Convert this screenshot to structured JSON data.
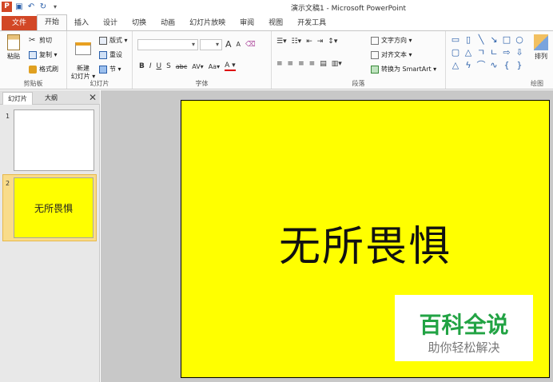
{
  "window": {
    "title": "演示文稿1 - Microsoft PowerPoint"
  },
  "qat": {
    "logo": "P"
  },
  "tabs": [
    "文件",
    "开始",
    "插入",
    "设计",
    "切换",
    "动画",
    "幻灯片放映",
    "审阅",
    "视图",
    "开发工具"
  ],
  "ribbon": {
    "clipboard": {
      "paste": "粘贴",
      "cut": "剪切",
      "copy": "复制 ▾",
      "format_painter": "格式刷",
      "label": "剪贴板"
    },
    "slides": {
      "new_slide": "新建\n幻灯片 ▾",
      "layout": "版式 ▾",
      "reset": "重设",
      "section": "节 ▾",
      "label": "幻灯片"
    },
    "font": {
      "label": "字体",
      "font_size_up": "A",
      "font_size_down": "A",
      "bold": "B",
      "italic": "I",
      "underline": "U",
      "strike": "S",
      "shadow": "abc",
      "spacing": "AV▾",
      "case": "Aa▾",
      "color": "A ▾"
    },
    "paragraph": {
      "text_direction": "文字方向 ▾",
      "align_text": "对齐文本 ▾",
      "smartart": "转换为 SmartArt ▾",
      "label": "段落"
    },
    "drawing": {
      "arrange": "排列",
      "label": "绘图"
    }
  },
  "left_panel": {
    "tab_slides": "幻灯片",
    "tab_outline": "大纲",
    "close": "✕",
    "slides": [
      {
        "number": "1",
        "text": ""
      },
      {
        "number": "2",
        "text": "无所畏惧"
      }
    ]
  },
  "slide": {
    "title": "无所畏惧",
    "background": "#ffff00"
  },
  "watermark": {
    "line1": "百科全说",
    "line2": "助你轻松解决"
  }
}
